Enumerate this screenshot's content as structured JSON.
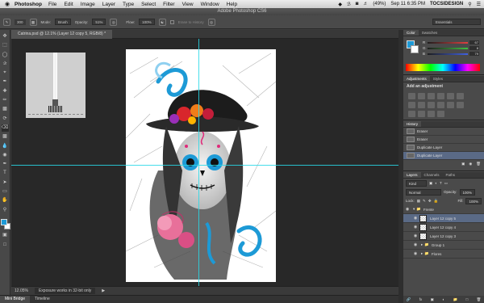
{
  "menubar": {
    "apple": "",
    "app": "Photoshop",
    "items": [
      "File",
      "Edit",
      "Image",
      "Layer",
      "Type",
      "Select",
      "Filter",
      "View",
      "Window",
      "Help"
    ],
    "battery": "(49%)",
    "clock": "Sep 11  6:35 PM",
    "user": "TOCSIDESIGN"
  },
  "titlebar": {
    "title": "Adobe Photoshop CS6"
  },
  "options": {
    "brush_size": "300",
    "mode_label": "Mode:",
    "mode_value": "Brush",
    "opacity_label": "Opacity:",
    "opacity_value": "51%",
    "flow_label": "Flow:",
    "flow_value": "100%",
    "erase_history": "Erase to History",
    "workspace": "Essentials"
  },
  "document": {
    "tab": "Catrina.psd @ 12.1% (Layer 12 copy 5, RGB/8) *",
    "zoom": "12.05%",
    "status": "Exposure works in 32-bit only"
  },
  "bottom_tabs": [
    "Mini Bridge",
    "Timeline"
  ],
  "color_panel": {
    "tabs": [
      "Color",
      "Swatches"
    ],
    "sliders": [
      {
        "label": "R",
        "value": "67",
        "color": "#e05050"
      },
      {
        "label": "G",
        "value": "8",
        "color": "#50c050"
      },
      {
        "label": "B",
        "value": "79",
        "color": "#5070e0"
      }
    ],
    "fg_color": "#1e9ad6"
  },
  "adjustments": {
    "tabs": [
      "Adjustments",
      "Styles"
    ],
    "heading": "Add an adjustment"
  },
  "history": {
    "tabs": [
      "History"
    ],
    "items": [
      "Eraser",
      "Eraser",
      "Duplicate Layer",
      "Duplicate Layer"
    ],
    "selected_index": 3
  },
  "layers": {
    "tabs": [
      "Layers",
      "Channels",
      "Paths"
    ],
    "kind": "Kind",
    "blend": "Normal",
    "opacity_label": "Opacity:",
    "opacity_value": "100%",
    "lock_label": "Lock:",
    "fill_label": "Fill:",
    "fill_value": "100%",
    "items": [
      {
        "name": "Frente",
        "type": "group"
      },
      {
        "name": "Layer 12 copy 5",
        "type": "layer",
        "selected": true
      },
      {
        "name": "Layer 12 copy 4",
        "type": "layer"
      },
      {
        "name": "Layer 12 copy 3",
        "type": "layer"
      },
      {
        "name": "Group 1",
        "type": "group"
      },
      {
        "name": "Flores",
        "type": "group"
      }
    ]
  }
}
